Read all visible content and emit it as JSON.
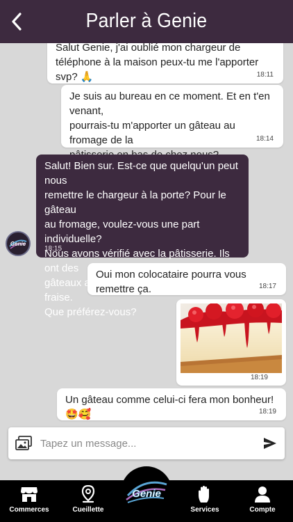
{
  "header": {
    "title": "Parler à Genie"
  },
  "messages": [
    {
      "text": "Salut Genie, j'ai oublié mon chargeur de téléphone à la maison peux-tu me l'apporter svp? 🙏",
      "time": "18:11"
    },
    {
      "text": "Je suis au bureau en ce moment. Et en t'en venant,\npourrais-tu m'apporter un gâteau au fromage de la\npâtisserie en bas de chez nous?",
      "time": "18:14"
    },
    {
      "text": "Salut! Bien sur. Est-ce que quelqu'un peut nous\nremettre le chargeur à la porte? Pour le gâteau\nau fromage, voulez-vous une part individuelle?\nNous avons vérifié avec la pâtisserie. Ils ont des\ngâteaux au fromage aux bleuets et à la fraise.\nQue préférez-vous?",
      "time": "18:15"
    },
    {
      "text": "Oui mon colocataire pourra vous remettre ça.",
      "time": "18:17"
    },
    {
      "time": "18:19"
    },
    {
      "text": "Un gâteau comme celui-ci fera mon bonheur! 🤩🥰",
      "time": "18:19"
    }
  ],
  "avatar": {
    "text": "Genie"
  },
  "composer": {
    "placeholder": "Tapez un message..."
  },
  "tabs": [
    {
      "label": "Commerces",
      "icon": "store-icon"
    },
    {
      "label": "Cueillette",
      "icon": "location-pin-icon"
    },
    {
      "label": "Services",
      "icon": "hand-icon"
    },
    {
      "label": "Compte",
      "icon": "user-icon"
    }
  ],
  "center_tab": {
    "text": "Genie"
  },
  "colors": {
    "primary": "#3d2a3f",
    "background": "#d8d8d8",
    "tabbar": "#000000"
  }
}
